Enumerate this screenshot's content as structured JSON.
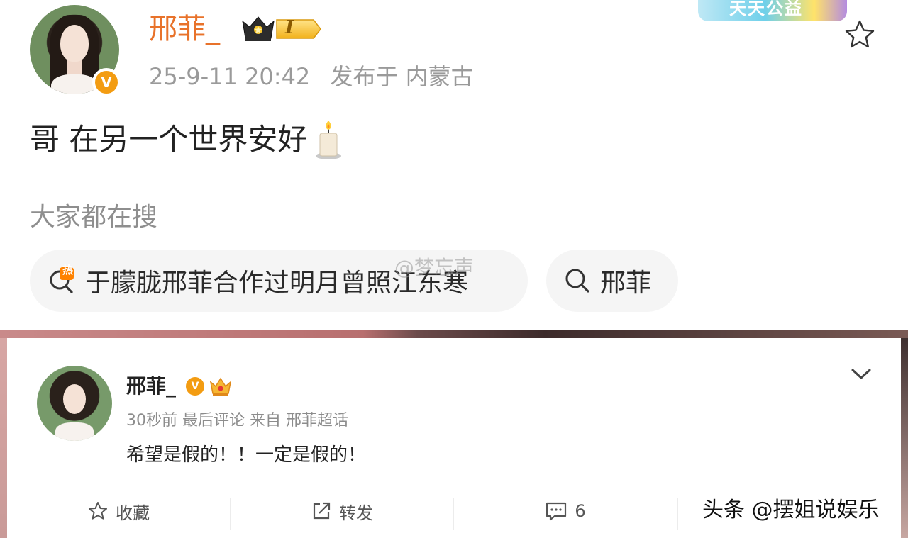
{
  "post": {
    "username": "邢菲_",
    "level_badge": "I",
    "timestamp": "25-9-11 20:42",
    "location": "发布于 内蒙古",
    "text": "哥 在另一个世界安好",
    "promo_banner": "天天公益"
  },
  "hot_search": {
    "label": "大家都在搜",
    "hot_tag": "热",
    "items": [
      {
        "text": "于朦胧邢菲合作过明月曾照江东寒"
      },
      {
        "text": "邢菲"
      }
    ]
  },
  "watermark": "@梦忘声",
  "comment_card": {
    "username": "邢菲_",
    "verified_badge": "V",
    "meta": "30秒前 最后评论 来自 邢菲超话",
    "text": "希望是假的！！一定是假的！",
    "actions": {
      "favorite": "收藏",
      "repost": "转发",
      "comments": "6"
    }
  },
  "source_mark": "头条 @摆姐说娱乐",
  "colors": {
    "username_orange": "#e8722a",
    "verified": "#f39c12",
    "gray_text": "#9a9a9a"
  }
}
